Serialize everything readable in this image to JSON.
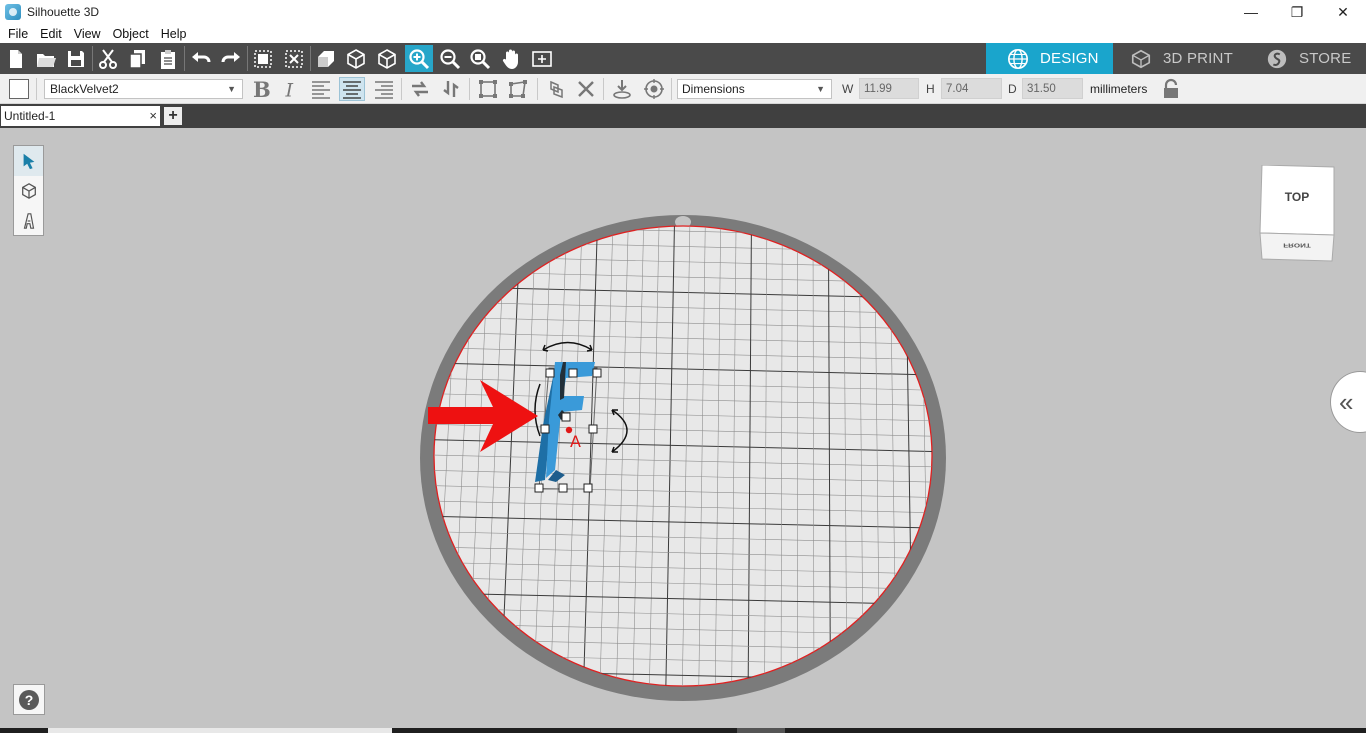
{
  "window": {
    "title": "Silhouette 3D",
    "minimize": "—",
    "maximize": "❐",
    "close": "✕"
  },
  "menu": [
    "File",
    "Edit",
    "View",
    "Object",
    "Help"
  ],
  "modes": [
    {
      "label": "DESIGN",
      "icon": "globe-icon",
      "active": true
    },
    {
      "label": "3D PRINT",
      "icon": "print-3d-icon",
      "active": false
    },
    {
      "label": "STORE",
      "icon": "store-icon",
      "active": false
    }
  ],
  "properties": {
    "font": "BlackVelvet2",
    "dimension_mode": "Dimensions",
    "w_label": "W",
    "w_value": "11.99",
    "h_label": "H",
    "h_value": "7.04",
    "d_label": "D",
    "d_value": "31.50",
    "units": "millimeters"
  },
  "tabs": {
    "document": "Untitled-1",
    "close": "×",
    "add": "+"
  },
  "view_cube": {
    "top": "TOP",
    "front": "FRONT"
  },
  "help": "?",
  "colors": {
    "accent": "#1aa5cc",
    "toolbar": "#4a4a4a",
    "model": "#3a9ad9",
    "arrow": "#ee1111"
  }
}
